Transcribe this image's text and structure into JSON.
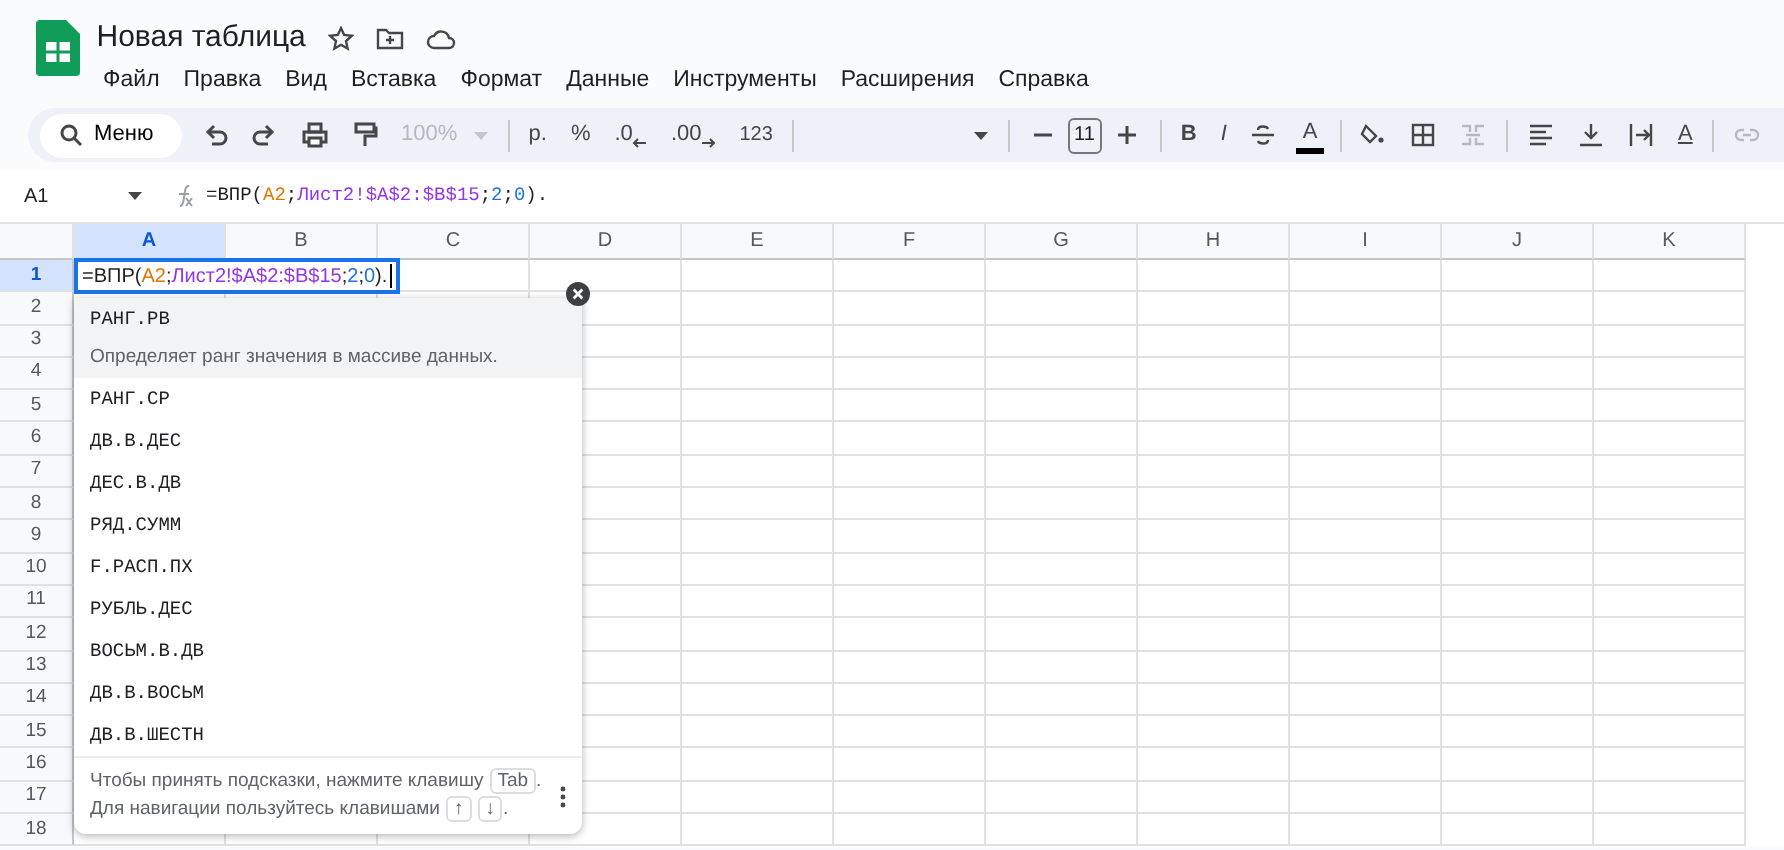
{
  "document": {
    "title": "Новая таблица"
  },
  "menu": [
    "Файл",
    "Правка",
    "Вид",
    "Вставка",
    "Формат",
    "Данные",
    "Инструменты",
    "Расширения",
    "Справка"
  ],
  "toolbar": {
    "search_label": "Меню",
    "zoom": "100%",
    "currency": "р.",
    "percent": "%",
    "decrease_decimals": ".0",
    "increase_decimals": ".00",
    "number_format": "123",
    "font_size": "11",
    "bold": "B",
    "italic": "I",
    "text_color": "A",
    "text_rotation": "A"
  },
  "formula_bar": {
    "cell_ref": "A1",
    "formula": [
      {
        "text": "=ВПР(",
        "kind": "plain"
      },
      {
        "text": "A2",
        "kind": "ref"
      },
      {
        "text": ";",
        "kind": "plain"
      },
      {
        "text": "Лист2!$A$2:$B$15",
        "kind": "range"
      },
      {
        "text": ";",
        "kind": "plain"
      },
      {
        "text": "2",
        "kind": "number"
      },
      {
        "text": ";",
        "kind": "plain"
      },
      {
        "text": "0",
        "kind": "number"
      },
      {
        "text": ").",
        "kind": "plain"
      }
    ]
  },
  "grid": {
    "columns": [
      {
        "label": "A",
        "selected": true
      },
      {
        "label": "B",
        "selected": false
      },
      {
        "label": "C",
        "selected": false
      },
      {
        "label": "D",
        "selected": false
      },
      {
        "label": "E",
        "selected": false
      },
      {
        "label": "F",
        "selected": false
      },
      {
        "label": "G",
        "selected": false
      },
      {
        "label": "H",
        "selected": false
      },
      {
        "label": "I",
        "selected": false
      },
      {
        "label": "J",
        "selected": false
      },
      {
        "label": "K",
        "selected": false
      }
    ],
    "rows": [
      {
        "label": "1",
        "selected": true
      },
      {
        "label": "2",
        "selected": false
      },
      {
        "label": "3",
        "selected": false
      },
      {
        "label": "4",
        "selected": false
      },
      {
        "label": "5",
        "selected": false
      },
      {
        "label": "6",
        "selected": false
      },
      {
        "label": "7",
        "selected": false
      },
      {
        "label": "8",
        "selected": false
      },
      {
        "label": "9",
        "selected": false
      },
      {
        "label": "10",
        "selected": false
      },
      {
        "label": "11",
        "selected": false
      },
      {
        "label": "12",
        "selected": false
      },
      {
        "label": "13",
        "selected": false
      },
      {
        "label": "14",
        "selected": false
      },
      {
        "label": "15",
        "selected": false
      },
      {
        "label": "16",
        "selected": false
      },
      {
        "label": "17",
        "selected": false
      },
      {
        "label": "18",
        "selected": false
      }
    ]
  },
  "cell_editor": {
    "formula": [
      {
        "text": "=ВПР(",
        "kind": "plain"
      },
      {
        "text": "A2",
        "kind": "ref"
      },
      {
        "text": ";",
        "kind": "plain"
      },
      {
        "text": "Лист2!$A$2:$B$15",
        "kind": "range"
      },
      {
        "text": ";",
        "kind": "plain"
      },
      {
        "text": "2",
        "kind": "number"
      },
      {
        "text": ";",
        "kind": "plain"
      },
      {
        "text": "0",
        "kind": "number"
      },
      {
        "text": ").",
        "kind": "plain"
      }
    ]
  },
  "suggestions": {
    "items": [
      {
        "name": "РАНГ.РВ",
        "description": "Определяет ранг значения в массиве данных.",
        "selected": true
      },
      {
        "name": "РАНГ.СР",
        "selected": false
      },
      {
        "name": "ДВ.В.ДЕС",
        "selected": false
      },
      {
        "name": "ДЕС.В.ДВ",
        "selected": false
      },
      {
        "name": "РЯД.СУММ",
        "selected": false
      },
      {
        "name": "F.РАСП.ПХ",
        "selected": false
      },
      {
        "name": "РУБЛЬ.ДЕС",
        "selected": false
      },
      {
        "name": "ВОСЬМ.В.ДВ",
        "selected": false
      },
      {
        "name": "ДВ.В.ВОСЬМ",
        "selected": false
      },
      {
        "name": "ДВ.В.ШЕСТН",
        "selected": false
      }
    ],
    "hint_accept": "Чтобы принять подсказки, нажмите клавишу",
    "accept_key": "Tab",
    "accept_end": ".",
    "hint_navigate": "Для навигации пользуйтесь клавишами",
    "up_key": "↑",
    "down_key": "↓",
    "navigate_end": "."
  }
}
